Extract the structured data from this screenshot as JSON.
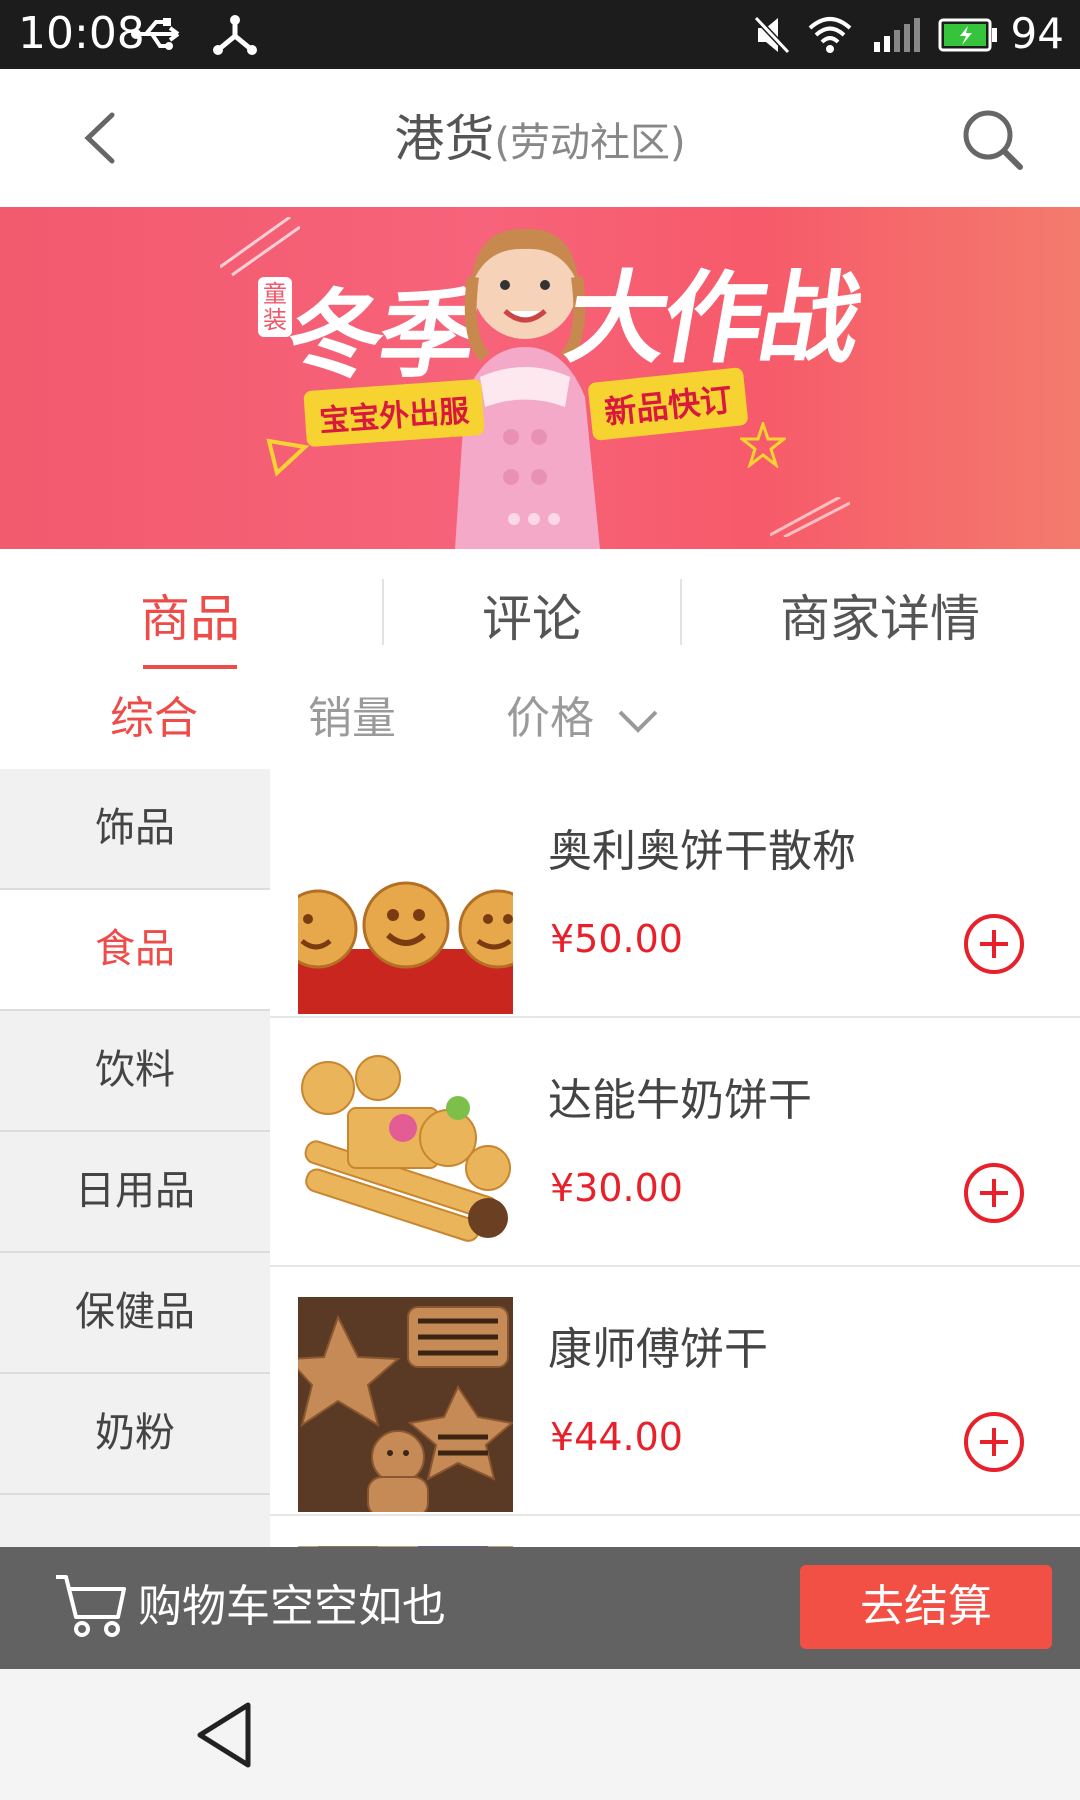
{
  "status_bar": {
    "time": "10:08",
    "battery_pct": "94",
    "icons": [
      "usb-icon",
      "debug-icon",
      "mute-icon",
      "wifi-icon",
      "signal-icon",
      "battery-icon"
    ]
  },
  "header": {
    "title": "港货",
    "subtitle": "(劳动社区)",
    "back_icon": "chevron-left-icon",
    "search_icon": "search-icon"
  },
  "banner": {
    "badge": "童装",
    "headline_1": "冬季",
    "headline_2": "大作战",
    "tag_1": "宝宝外出服",
    "tag_2": "新品快订",
    "colors": {
      "background": "#f7637a",
      "tag": "#f7d331"
    }
  },
  "tabs": [
    {
      "label": "商品",
      "active": true
    },
    {
      "label": "评论",
      "active": false
    },
    {
      "label": "商家详情",
      "active": false
    }
  ],
  "sort_options": [
    {
      "label": "综合",
      "active": true
    },
    {
      "label": "销量",
      "active": false
    },
    {
      "label": "价格",
      "active": false,
      "icon": "chevron-down-icon"
    }
  ],
  "categories": [
    {
      "label": "饰品",
      "active": false
    },
    {
      "label": "食品",
      "active": true
    },
    {
      "label": "饮料",
      "active": false
    },
    {
      "label": "日用品",
      "active": false
    },
    {
      "label": "保健品",
      "active": false
    },
    {
      "label": "奶粉",
      "active": false
    }
  ],
  "products": [
    {
      "name": "奥利奥饼干散称",
      "price": "¥50.00",
      "image": "smiley-cookies-image"
    },
    {
      "name": "达能牛奶饼干",
      "price": "¥30.00",
      "image": "assorted-biscuits-image"
    },
    {
      "name": "康师傅饼干",
      "price": "¥44.00",
      "image": "gingerbread-cookies-image"
    }
  ],
  "cart": {
    "empty_text": "购物车空空如也",
    "checkout_label": "去结算",
    "icon": "cart-icon"
  },
  "nav": {
    "back_icon": "nav-back-icon"
  },
  "colors": {
    "accent": "#ee4c49",
    "price": "#e8202a",
    "cart_bar": "#626262",
    "checkout": "#f24f45"
  }
}
